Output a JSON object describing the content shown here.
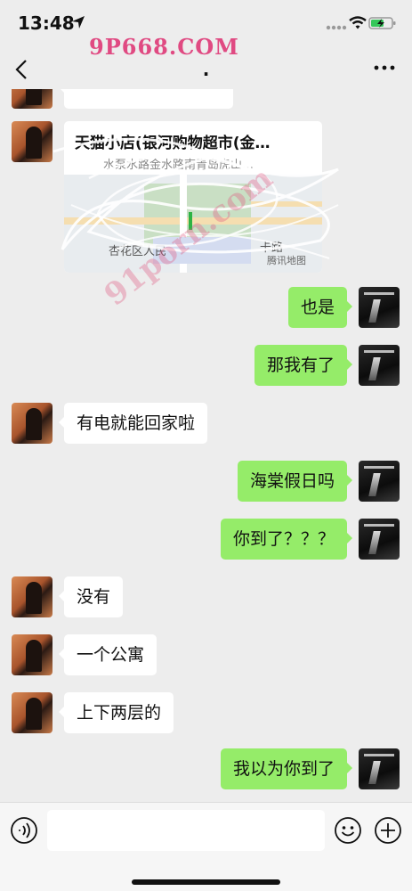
{
  "status_bar": {
    "time": "13:48",
    "icons": [
      "location-arrow-icon",
      "signal-icon",
      "wifi-icon",
      "battery-charging-icon"
    ]
  },
  "watermark": {
    "top_text": "9P668.COM",
    "diagonal_text": "91porn.com"
  },
  "nav": {
    "title": ".",
    "back_icon": "chevron-left-icon",
    "more_icon": "more-dots-icon"
  },
  "location_message": {
    "name": "天猫小店(银河购物超市(金…",
    "address": "水泵水路金水路南青岛虎山…",
    "map_labels": [
      "杏花区人民",
      "卡路",
      "腾讯地图"
    ]
  },
  "messages": [
    {
      "side": "right",
      "text": "也是"
    },
    {
      "side": "right",
      "text": "那我有了"
    },
    {
      "side": "left",
      "text": "有电就能回家啦"
    },
    {
      "side": "right",
      "text": "海棠假日吗"
    },
    {
      "side": "right",
      "text": "你到了？？？"
    },
    {
      "side": "left",
      "text": "没有"
    },
    {
      "side": "left",
      "text": "一个公寓"
    },
    {
      "side": "left",
      "text": "上下两层的"
    },
    {
      "side": "right",
      "text": "我以为你到了"
    }
  ],
  "input_bar": {
    "placeholder": "",
    "icons": [
      "voice-icon",
      "emoji-icon",
      "plus-icon"
    ]
  },
  "colors": {
    "background": "#ededed",
    "bubble_sent": "#95ec69",
    "bubble_received": "#ffffff",
    "watermark": "#e04a82"
  }
}
